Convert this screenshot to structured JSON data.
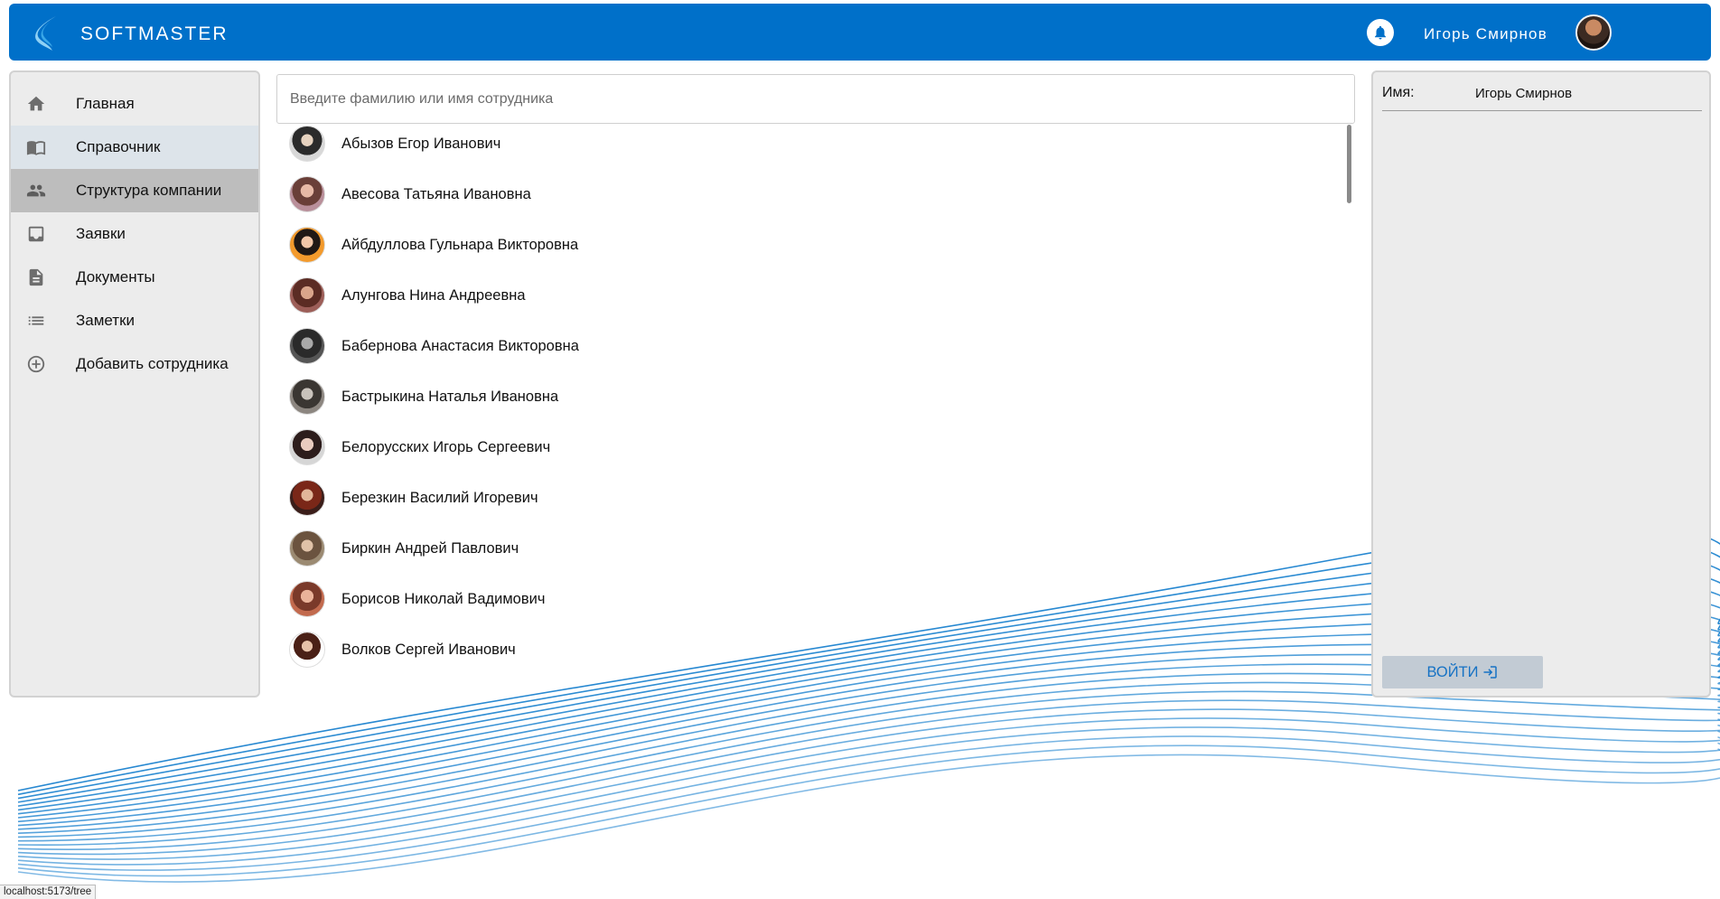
{
  "header": {
    "brand": "SOFTMASTER",
    "user_name": "Игорь Смирнов",
    "icons": [
      "logo-icon",
      "bell-icon",
      "avatar"
    ]
  },
  "sidebar": {
    "items": [
      {
        "label": "Главная",
        "icon": "home-icon",
        "state": "default"
      },
      {
        "label": "Справочник",
        "icon": "book-icon",
        "state": "hover"
      },
      {
        "label": "Структура компании",
        "icon": "people-icon",
        "state": "active"
      },
      {
        "label": "Заявки",
        "icon": "inbox-icon",
        "state": "default"
      },
      {
        "label": "Документы",
        "icon": "document-icon",
        "state": "default"
      },
      {
        "label": "Заметки",
        "icon": "list-icon",
        "state": "default"
      },
      {
        "label": "Добавить сотрудника",
        "icon": "add-circle-icon",
        "state": "default"
      }
    ]
  },
  "search": {
    "placeholder": "Введите фамилию или имя сотрудника",
    "value": ""
  },
  "employees": [
    {
      "name": "Абызов Егор Иванович"
    },
    {
      "name": "Авесова Татьяна Ивановна"
    },
    {
      "name": "Айбдуллова Гульнара Викторовна"
    },
    {
      "name": "Алунгова Нина Андреевна"
    },
    {
      "name": "Бабернова Анастасия Викторовна"
    },
    {
      "name": "Бастрыкина Наталья Ивановна"
    },
    {
      "name": "Белорусских Игорь Сергеевич"
    },
    {
      "name": "Березкин Василий Игоревич"
    },
    {
      "name": "Биркин Андрей Павлович"
    },
    {
      "name": "Борисов Николай Вадимович"
    },
    {
      "name": "Волков Сергей Иванович"
    }
  ],
  "details": {
    "name_label": "Имя:",
    "name_value": "Игорь Смирнов",
    "login_label": "ВОЙТИ"
  },
  "status_bar": {
    "url": "localhost:5173/tree"
  },
  "colors": {
    "header": "#0070c9",
    "panel_bg": "#ececec",
    "active_nav": "#bdbdbd",
    "hover_nav": "#dde4ea",
    "login_text": "#1672c4",
    "wave": "#1b82cf"
  }
}
